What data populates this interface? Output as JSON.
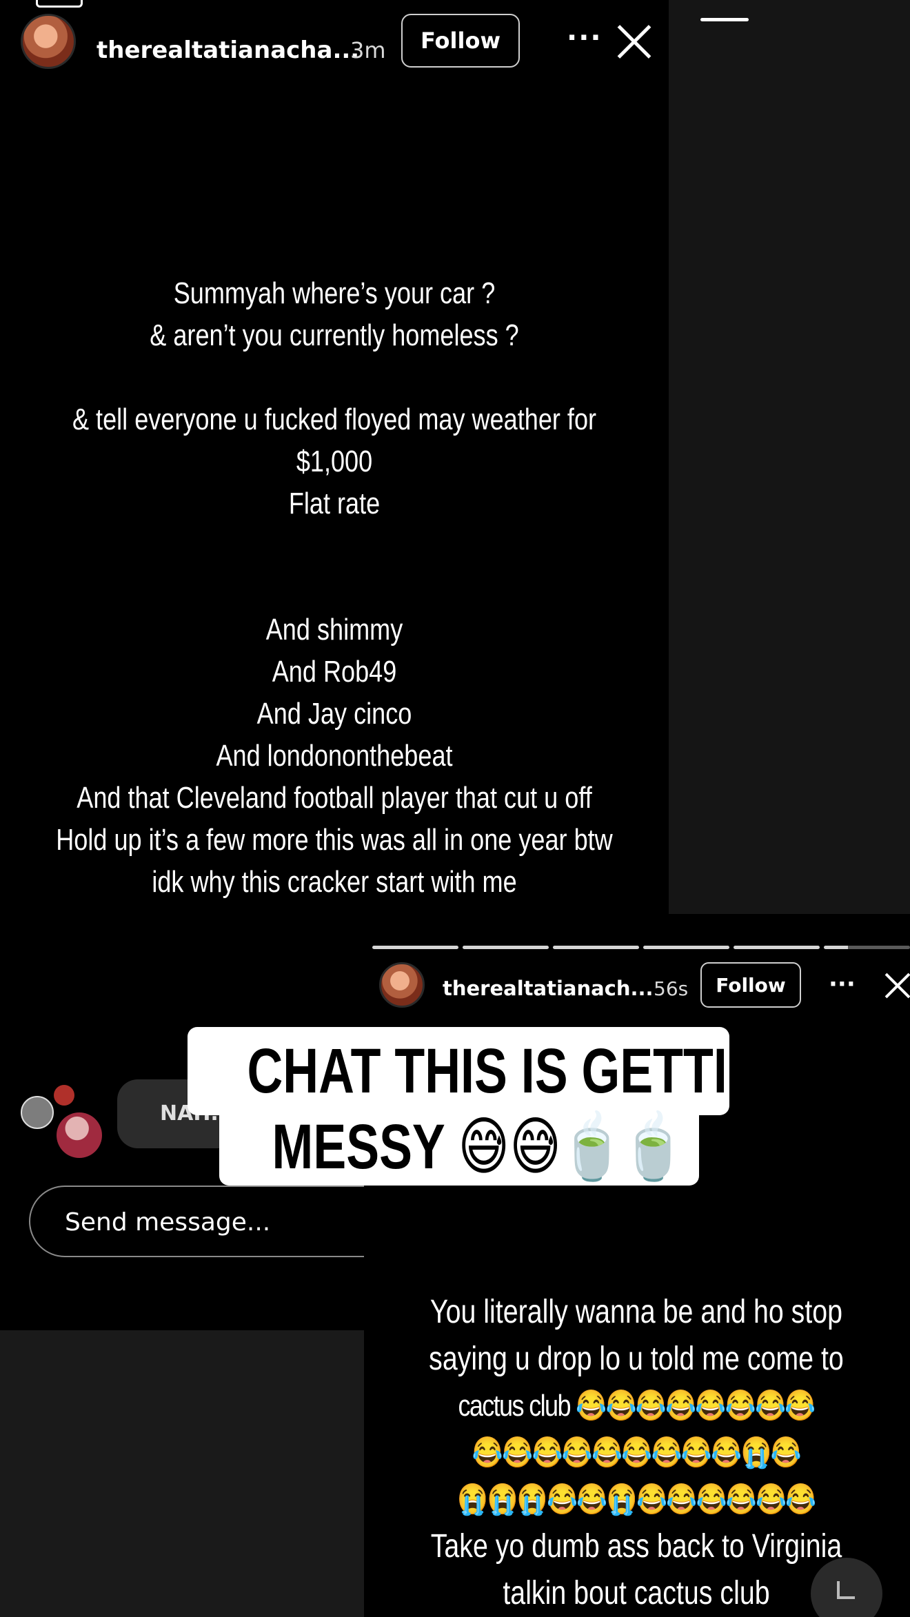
{
  "story1": {
    "username": "therealtatianacha...",
    "time": "3m",
    "follow_label": "Follow",
    "more_label": "···",
    "text_lines": [
      "Summyah where’s your car ?",
      "& aren’t you currently homeless ?",
      "",
      "& tell everyone u fucked floyed may weather for",
      "$1,000",
      "Flat rate",
      "",
      "",
      "And shimmy",
      "And Rob49",
      "And Jay cinco",
      "And londononthebeat",
      "And that Cleveland football player that cut u off",
      "Hold up it’s a few more this was all in one year btw",
      "idk why this cracker start with me"
    ],
    "comment_text": "NAH...",
    "send_placeholder": "Send message..."
  },
  "story2": {
    "username": "therealtatianach...",
    "time": "56s",
    "follow_label": "Follow",
    "more_label": "···",
    "text_lines": [
      "You literally wanna be and ho stop",
      "saying u drop lo u told me come to",
      "cactus club 😂😂😂😂😂😂😂😂",
      "😂😂😂😂😂😂😂😂😂😭😂",
      "😭😭😭😂😂😭😂😂😂😂😂😂",
      "Take yo dumb ass back to Virginia",
      "talkin bout cactus club"
    ]
  },
  "caption": {
    "line1": "CHAT THIS IS GETTING",
    "line2": "MESSY 😅😅🍵🍵"
  }
}
